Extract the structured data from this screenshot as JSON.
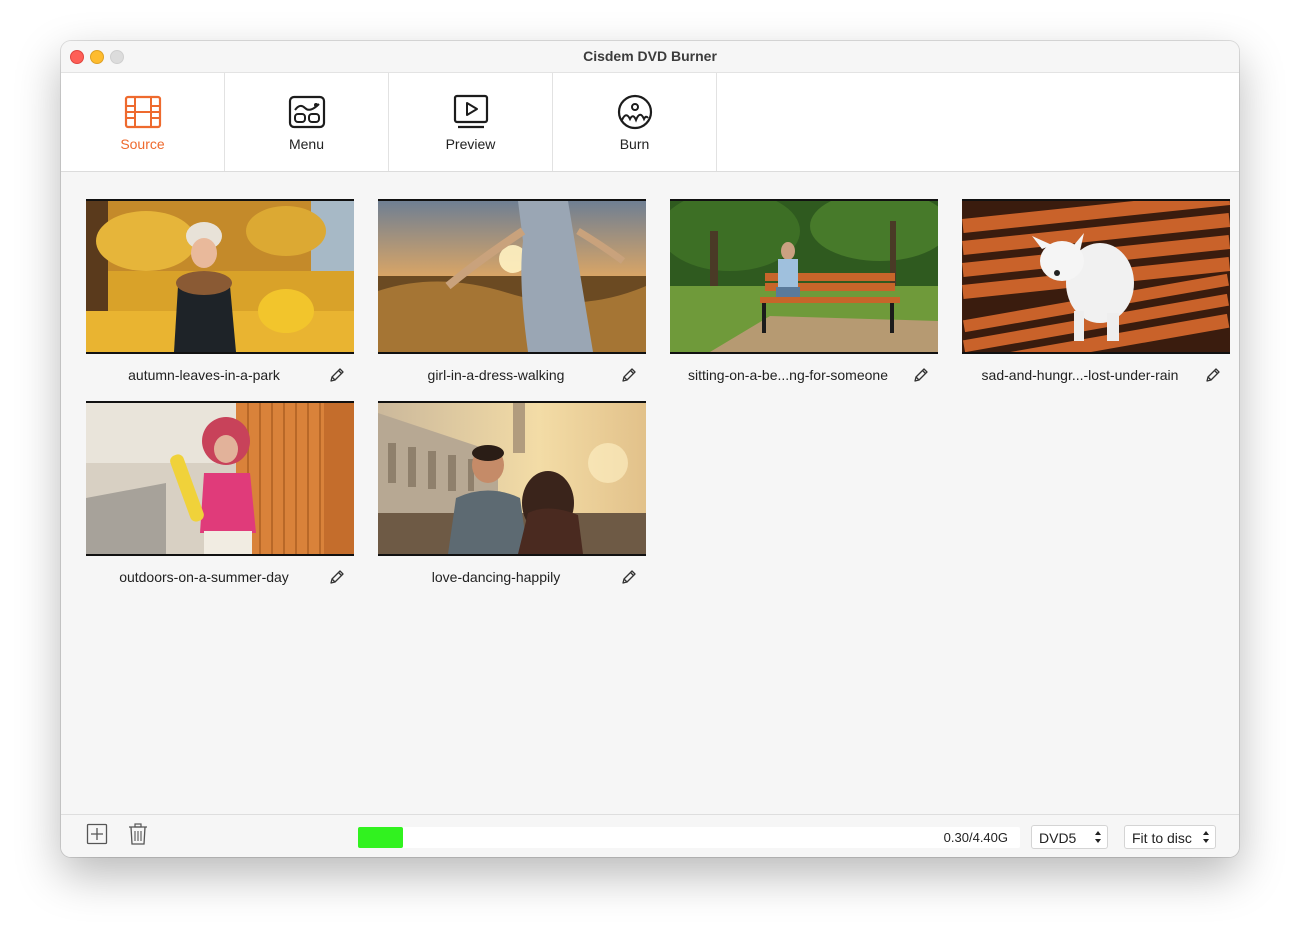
{
  "window": {
    "title": "Cisdem DVD Burner"
  },
  "toolbar": {
    "tabs": [
      {
        "label": "Source",
        "icon": "film-icon",
        "active": true
      },
      {
        "label": "Menu",
        "icon": "menu-layout-icon",
        "active": false
      },
      {
        "label": "Preview",
        "icon": "play-screen-icon",
        "active": false
      },
      {
        "label": "Burn",
        "icon": "disc-burn-icon",
        "active": false
      }
    ],
    "accent_color": "#ee6a2e"
  },
  "videos": [
    {
      "name": "autumn-leaves-in-a-park"
    },
    {
      "name": "girl-in-a-dress-walking"
    },
    {
      "name": "sitting-on-a-be...ng-for-someone"
    },
    {
      "name": "sad-and-hungr...-lost-under-rain"
    },
    {
      "name": "outdoors-on-a-summer-day"
    },
    {
      "name": "love-dancing-happily"
    }
  ],
  "bottom": {
    "add_icon": "plus-square-icon",
    "delete_icon": "trash-icon",
    "capacity": {
      "text": "0.30/4.40G",
      "fraction": 0.068,
      "color": "#31f21f"
    },
    "disc_type": "DVD5",
    "quality": "Fit to disc"
  }
}
